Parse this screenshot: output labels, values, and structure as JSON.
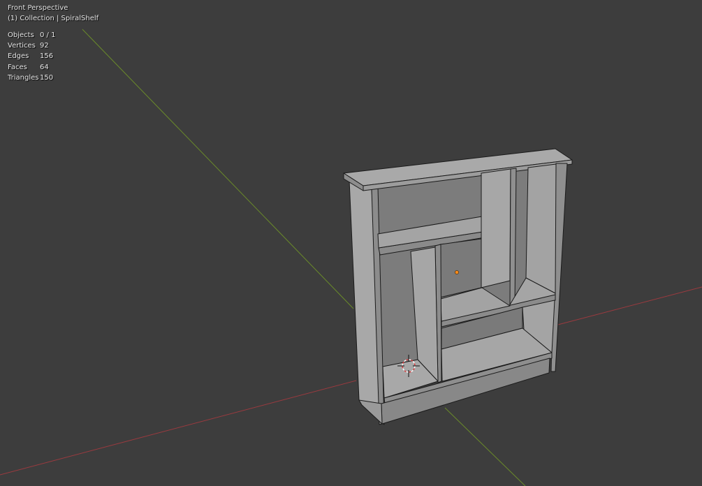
{
  "viewport": {
    "view_name": "Front Perspective",
    "collection_info": "(1) Collection | SpiralShelf",
    "stats": [
      {
        "label": "Objects",
        "value": "0 / 1"
      },
      {
        "label": "Vertices",
        "value": "92"
      },
      {
        "label": "Edges",
        "value": "156"
      },
      {
        "label": "Faces",
        "value": "64"
      },
      {
        "label": "Triangles",
        "value": "150"
      }
    ],
    "colors": {
      "background": "#3d3d3d",
      "x_axis": "#9b3a3f",
      "y_axis": "#6a8b2a",
      "origin_point": "#ff8c1a",
      "mesh_light": "#a9a9a9",
      "mesh_mid": "#8f8f8f",
      "mesh_dark": "#787878",
      "edge": "#1a1a1a"
    }
  }
}
